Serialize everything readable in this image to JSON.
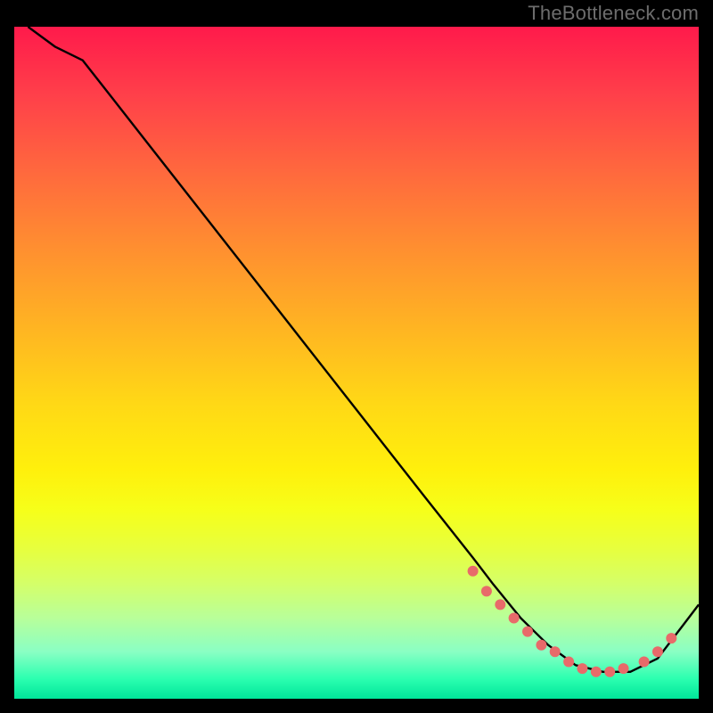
{
  "watermark": "TheBottleneck.com",
  "chart_data": {
    "type": "line",
    "title": "",
    "xlabel": "",
    "ylabel": "",
    "xlim": [
      0,
      100
    ],
    "ylim": [
      0,
      100
    ],
    "series": [
      {
        "name": "curve",
        "x": [
          2,
          6,
          10,
          20,
          30,
          40,
          50,
          60,
          67,
          70,
          74,
          78,
          82,
          86,
          90,
          94,
          100
        ],
        "y": [
          100,
          97,
          95,
          82,
          69,
          56,
          43,
          30,
          21,
          17,
          12,
          8,
          5,
          4,
          4,
          6,
          14
        ]
      }
    ],
    "highlight_points": {
      "name": "bottleneck-band",
      "x": [
        67,
        69,
        71,
        73,
        75,
        77,
        79,
        81,
        83,
        85,
        87,
        89,
        92,
        94,
        96
      ],
      "y": [
        19,
        16,
        14,
        12,
        10,
        8,
        7,
        5.5,
        4.5,
        4,
        4,
        4.5,
        5.5,
        7,
        9
      ]
    },
    "gradient_stops": [
      {
        "pos": 0.0,
        "color": "#ff1a4b"
      },
      {
        "pos": 0.5,
        "color": "#ffd816"
      },
      {
        "pos": 0.97,
        "color": "#2cffb0"
      },
      {
        "pos": 1.0,
        "color": "#00e59a"
      }
    ]
  }
}
